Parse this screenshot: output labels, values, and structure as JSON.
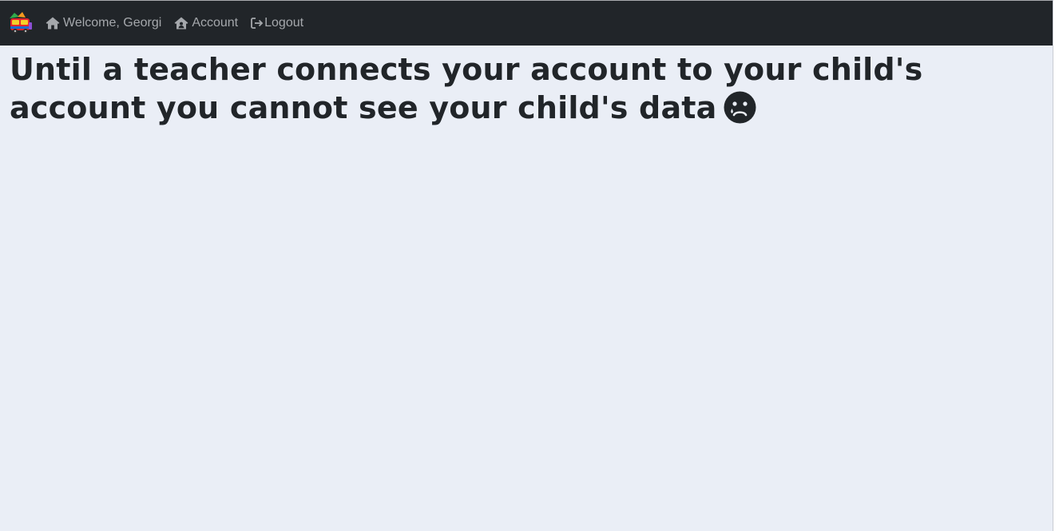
{
  "navbar": {
    "logo_icon": "school-bus-logo-icon",
    "items": [
      {
        "icon": "home-icon",
        "label": "Welcome, Georgi"
      },
      {
        "icon": "house-user-icon",
        "label": "Account"
      },
      {
        "icon": "logout-icon",
        "label": "Logout"
      }
    ]
  },
  "main": {
    "message": "Until a teacher connects your account to your child's account you cannot see your child's data",
    "message_icon": "sad-tear-icon"
  },
  "colors": {
    "navbar_bg": "#212529",
    "nav_link": "#a5a8ac",
    "page_bg": "#eaeef6",
    "text": "#212529"
  }
}
